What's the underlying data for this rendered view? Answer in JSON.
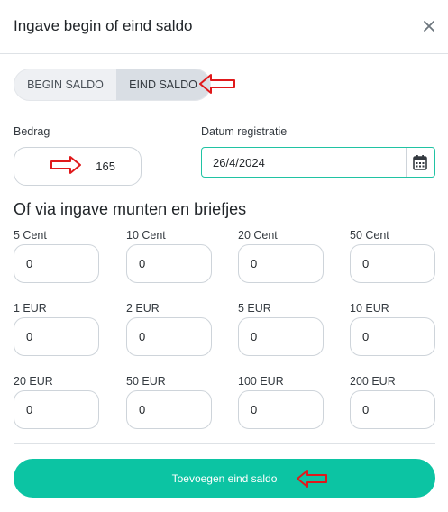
{
  "modal": {
    "title": "Ingave begin of eind saldo",
    "close_icon": "close-icon"
  },
  "toggle": {
    "options": [
      "BEGIN SALDO",
      "EIND SALDO"
    ],
    "selected": "EIND SALDO"
  },
  "amount": {
    "label": "Bedrag",
    "value": "165"
  },
  "date": {
    "label": "Datum registratie",
    "value": "26/4/2024",
    "icon": "calendar-icon"
  },
  "coins": {
    "title": "Of via ingave munten en briefjes",
    "items": [
      {
        "label": "5 Cent",
        "value": "0"
      },
      {
        "label": "10 Cent",
        "value": "0"
      },
      {
        "label": "20 Cent",
        "value": "0"
      },
      {
        "label": "50 Cent",
        "value": "0"
      },
      {
        "label": "1 EUR",
        "value": "0"
      },
      {
        "label": "2 EUR",
        "value": "0"
      },
      {
        "label": "5 EUR",
        "value": "0"
      },
      {
        "label": "10 EUR",
        "value": "0"
      },
      {
        "label": "20 EUR",
        "value": "0"
      },
      {
        "label": "50 EUR",
        "value": "0"
      },
      {
        "label": "100 EUR",
        "value": "0"
      },
      {
        "label": "200 EUR",
        "value": "0"
      }
    ]
  },
  "submit": {
    "label": "Toevoegen eind saldo"
  },
  "colors": {
    "accent": "#0cc4a3",
    "annotation_arrow": "#e0191b"
  }
}
